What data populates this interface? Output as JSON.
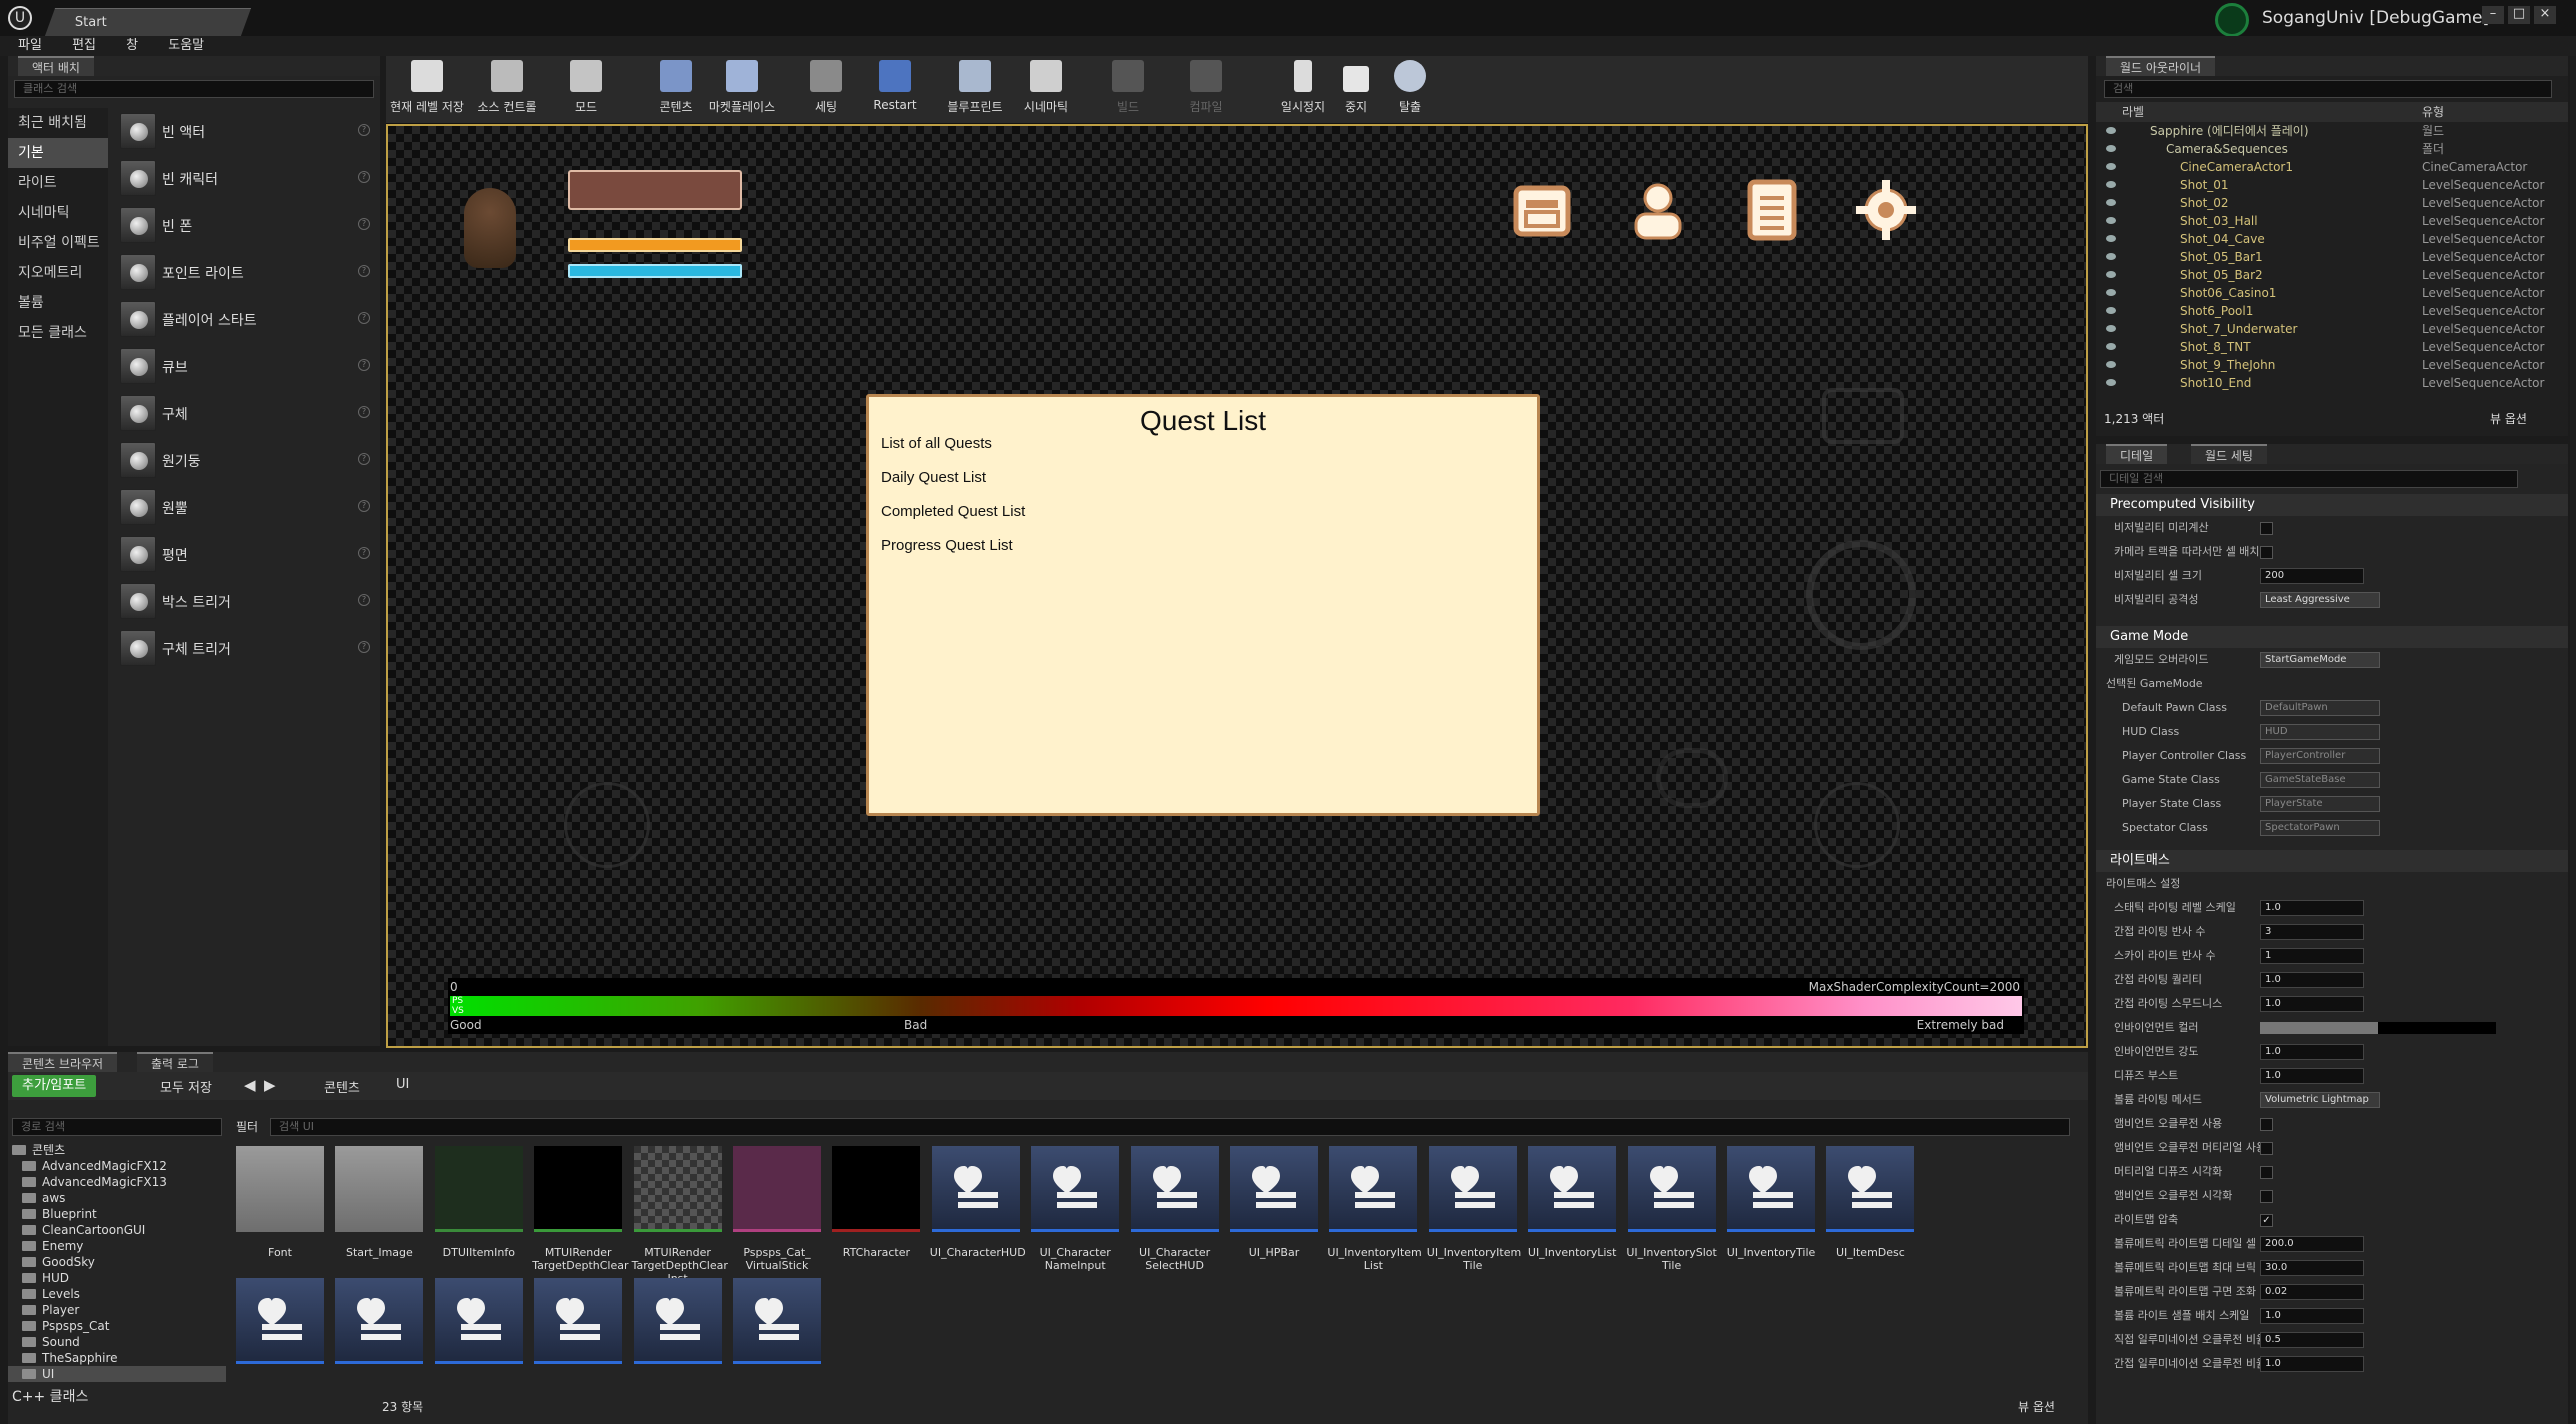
{
  "window": {
    "tab_title": "Start",
    "brand": "SogangUniv [DebugGame]",
    "controls": [
      "–",
      "□",
      "×"
    ]
  },
  "menu": [
    "파일",
    "편집",
    "창",
    "도움말"
  ],
  "place_panel": {
    "tab": "액터 배치",
    "search_placeholder": "클래스 검색",
    "categories": [
      "최근 배치됨",
      "기본",
      "라이트",
      "시네마틱",
      "비주얼 이펙트",
      "지오메트리",
      "볼륨",
      "모든 클래스"
    ],
    "selected_category": "기본",
    "items": [
      "빈 액터",
      "빈 캐릭터",
      "빈 폰",
      "포인트 라이트",
      "플레이어 스타트",
      "큐브",
      "구체",
      "원기둥",
      "원뿔",
      "평면",
      "박스 트리거",
      "구체 트리거"
    ]
  },
  "toolbar": {
    "buttons": [
      {
        "label": "현재 레벨 저장",
        "icon": "save-icon"
      },
      {
        "label": "소스 컨트롤",
        "icon": "source-control-icon"
      },
      {
        "label": "모드",
        "icon": "modes-icon"
      },
      {
        "label": "콘텐츠",
        "icon": "content-icon"
      },
      {
        "label": "마켓플레이스",
        "icon": "marketplace-icon"
      },
      {
        "label": "세팅",
        "icon": "settings-icon"
      },
      {
        "label": "Restart",
        "icon": "restart-icon"
      },
      {
        "label": "블루프린트",
        "icon": "blueprint-icon"
      },
      {
        "label": "시네마틱",
        "icon": "cinematics-icon"
      },
      {
        "label": "빌드",
        "icon": "build-icon"
      },
      {
        "label": "컴파일",
        "icon": "compile-icon"
      },
      {
        "label": "일시정지",
        "icon": "pause-icon"
      },
      {
        "label": "중지",
        "icon": "stop-icon"
      },
      {
        "label": "탈출",
        "icon": "eject-icon"
      }
    ]
  },
  "viewport": {
    "quest": {
      "title": "Quest List",
      "items": [
        "List of all Quests",
        "Daily Quest List",
        "Completed Quest List",
        "Progress Quest List"
      ]
    },
    "complexity": {
      "zero": "0",
      "max": "MaxShaderComplexityCount=2000",
      "ps": "PS",
      "vs": "VS",
      "good": "Good",
      "bad": "Bad",
      "extreme": "Extremely bad"
    }
  },
  "outliner": {
    "tab": "월드 아웃라이너",
    "search_placeholder": "검색",
    "col_label": "라벨",
    "col_type": "유형",
    "rows": [
      {
        "name": "Sapphire (에디터에서 플레이)",
        "type": "월드"
      },
      {
        "name": "Camera&Sequences",
        "type": "폴더"
      },
      {
        "name": "CineCameraActor1",
        "type": "CineCameraActor"
      },
      {
        "name": "Shot_01",
        "type": "LevelSequenceActor"
      },
      {
        "name": "Shot_02",
        "type": "LevelSequenceActor"
      },
      {
        "name": "Shot_03_Hall",
        "type": "LevelSequenceActor"
      },
      {
        "name": "Shot_04_Cave",
        "type": "LevelSequenceActor"
      },
      {
        "name": "Shot_05_Bar1",
        "type": "LevelSequenceActor"
      },
      {
        "name": "Shot_05_Bar2",
        "type": "LevelSequenceActor"
      },
      {
        "name": "Shot06_Casino1",
        "type": "LevelSequenceActor"
      },
      {
        "name": "Shot6_Pool1",
        "type": "LevelSequenceActor"
      },
      {
        "name": "Shot_7_Underwater",
        "type": "LevelSequenceActor"
      },
      {
        "name": "Shot_8_TNT",
        "type": "LevelSequenceActor"
      },
      {
        "name": "Shot_9_TheJohn",
        "type": "LevelSequenceActor"
      },
      {
        "name": "Shot10_End",
        "type": "LevelSequenceActor"
      }
    ],
    "count": "1,213 액터",
    "view_options": "뷰 옵션"
  },
  "details": {
    "tab1": "디테일",
    "tab2": "월드 세팅",
    "search_placeholder": "디테일 검색",
    "precomputed": {
      "title": "Precomputed Visibility",
      "rows": [
        {
          "label": "비저빌리티 미리계산",
          "kind": "check"
        },
        {
          "label": "카메라 트랙을 따라서만 셀 배치",
          "kind": "check"
        },
        {
          "label": "비저빌리티 셀 크기",
          "kind": "value",
          "value": "200"
        },
        {
          "label": "비저빌리티 공격성",
          "kind": "dd",
          "value": "Least Aggressive"
        }
      ]
    },
    "gamemode": {
      "title": "Game Mode",
      "override_label": "게임모드 오버라이드",
      "override_value": "StartGameMode",
      "selected_label": "선택된 GameMode",
      "rows": [
        {
          "label": "Default Pawn Class",
          "value": "DefaultPawn"
        },
        {
          "label": "HUD Class",
          "value": "HUD"
        },
        {
          "label": "Player Controller Class",
          "value": "PlayerController"
        },
        {
          "label": "Game State Class",
          "value": "GameStateBase"
        },
        {
          "label": "Player State Class",
          "value": "PlayerState"
        },
        {
          "label": "Spectator Class",
          "value": "SpectatorPawn"
        }
      ]
    },
    "lightmass": {
      "title": "라이트매스",
      "sub": "라이트매스 설정",
      "rows": [
        {
          "label": "스태틱 라이팅 레벨 스케일",
          "kind": "value",
          "value": "1.0"
        },
        {
          "label": "간접 라이팅 반사 수",
          "kind": "value",
          "value": "3"
        },
        {
          "label": "스카이 라이트 반사 수",
          "kind": "value",
          "value": "1"
        },
        {
          "label": "간접 라이팅 퀄리티",
          "kind": "value",
          "value": "1.0"
        },
        {
          "label": "간접 라이팅 스무드니스",
          "kind": "value",
          "value": "1.0"
        },
        {
          "label": "인바이언먼트 컬러",
          "kind": "color"
        },
        {
          "label": "인바이언먼트 강도",
          "kind": "value",
          "value": "1.0"
        },
        {
          "label": "디퓨즈 부스트",
          "kind": "value",
          "value": "1.0"
        },
        {
          "label": "볼륨 라이팅 메서드",
          "kind": "dd",
          "value": "Volumetric Lightmap"
        },
        {
          "label": "앰비언트 오클루전 사용",
          "kind": "check"
        },
        {
          "label": "앰비언트 오클루전 머티리얼 사용",
          "kind": "check"
        },
        {
          "label": "머티리얼 디퓨즈 시각화",
          "kind": "check"
        },
        {
          "label": "앰비언트 오클루전 시각화",
          "kind": "check"
        },
        {
          "label": "라이트맵 압축",
          "kind": "check",
          "checked": true
        },
        {
          "label": "볼류메트릭 라이트맵 디테일 셀 크기",
          "kind": "value",
          "value": "200.0"
        },
        {
          "label": "볼류메트릭 라이트맵 최대 브릭 메모리",
          "kind": "value",
          "value": "30.0"
        },
        {
          "label": "볼류메트릭 라이트맵 구면 조화 스무딩",
          "kind": "value",
          "value": "0.02"
        },
        {
          "label": "볼륨 라이트 샘플 배치 스케일",
          "kind": "value",
          "value": "1.0"
        },
        {
          "label": "직접 일루미네이션 오클루전 비율",
          "kind": "value",
          "value": "0.5"
        },
        {
          "label": "간접 일루미네이션 오클루전 비율",
          "kind": "value",
          "value": "1.0"
        }
      ]
    }
  },
  "content_browser": {
    "tab1": "콘텐츠 브라우저",
    "tab2": "출력 로그",
    "add_import": "추가/임포트",
    "save_all": "모두 저장",
    "path_root": "콘텐츠",
    "path_ui": "UI",
    "path_search_placeholder": "경로 검색",
    "filter": "필터",
    "asset_search_placeholder": "검색 UI",
    "tree_root": "콘텐츠",
    "folders": [
      "AdvancedMagicFX12",
      "AdvancedMagicFX13",
      "aws",
      "Blueprint",
      "CleanCartoonGUI",
      "Enemy",
      "GoodSky",
      "HUD",
      "Levels",
      "Player",
      "Pspsps_Cat",
      "Sound",
      "TheSapphire",
      "UI"
    ],
    "cpp": "C++ 클래스",
    "assets": [
      {
        "name": "Font",
        "kind": "folder"
      },
      {
        "name": "Start_Image",
        "kind": "folder"
      },
      {
        "name": "DTUIItemInfo",
        "kind": "datatable"
      },
      {
        "name": "MTUIRender TargetDepthClear",
        "kind": "material"
      },
      {
        "name": "MTUIRender TargetDepthClear Inst",
        "kind": "matinst"
      },
      {
        "name": "Pspsps_Cat_ VirtualStick",
        "kind": "texture"
      },
      {
        "name": "RTCharacter",
        "kind": "rendertarget"
      },
      {
        "name": "UI_CharacterHUD",
        "kind": "widget"
      },
      {
        "name": "UI_Character NameInput",
        "kind": "widget"
      },
      {
        "name": "UI_Character SelectHUD",
        "kind": "widget"
      },
      {
        "name": "UI_HPBar",
        "kind": "widget"
      },
      {
        "name": "UI_InventoryItem List",
        "kind": "widget"
      },
      {
        "name": "UI_InventoryItem Tile",
        "kind": "widget"
      },
      {
        "name": "UI_InventoryList",
        "kind": "widget"
      },
      {
        "name": "UI_InventorySlot Tile",
        "kind": "widget"
      },
      {
        "name": "UI_InventoryTile",
        "kind": "widget"
      },
      {
        "name": "UI_ItemDesc",
        "kind": "widget"
      }
    ],
    "extra_widget_count": 6,
    "item_count": "23 항목",
    "view_options": "뷰 옵션"
  }
}
